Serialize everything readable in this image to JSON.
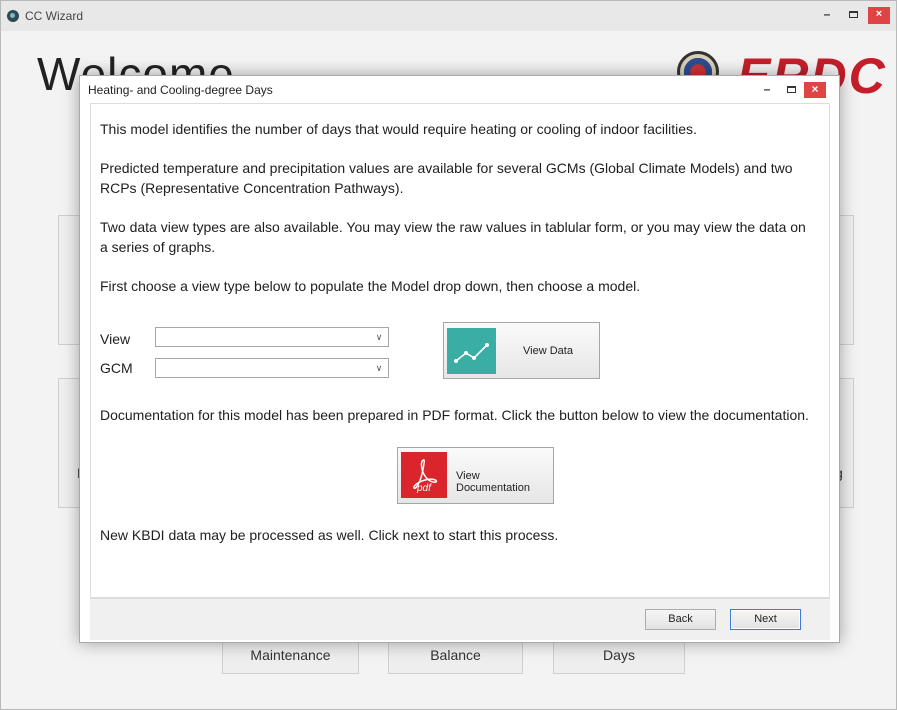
{
  "main_window": {
    "title": "CC Wizard",
    "heading": "Welcome",
    "logo_text": "ERDC",
    "controls": {
      "minimize": "–",
      "close": "×"
    },
    "partial_labels": {
      "left": "M",
      "right": "g"
    },
    "bottom_buttons": [
      {
        "label": "Maintenance"
      },
      {
        "label": "Balance"
      },
      {
        "label": "Days"
      }
    ]
  },
  "dialog": {
    "title": "Heating- and Cooling-degree Days",
    "controls": {
      "minimize": "–",
      "close": "×"
    },
    "paragraphs": {
      "intro": "This model identifies the number of days that would require heating or cooling of indoor facilities.",
      "values": "Predicted temperature and precipitation values are available for several GCMs (Global Climate Models) and two RCPs (Representative Concentration Pathways).",
      "view_types": "Two data view types are also available. You may view the raw values in tablular form, or you may view the data on a series of graphs.",
      "instructions": "First choose a view type below to populate the Model drop down, then choose a model.",
      "documentation": "Documentation for this model has been prepared in PDF format. Click the button below to view the documentation.",
      "kbdi": "New KBDI data may be processed as well. Click next to start this process."
    },
    "fields": {
      "view_label": "View",
      "view_value": "",
      "gcm_label": "GCM",
      "gcm_value": "",
      "arrow": "∨"
    },
    "buttons": {
      "view_data": "View Data",
      "view_documentation": "View Documentation",
      "pdf_badge": "pdf",
      "back": "Back",
      "next": "Next"
    },
    "colors": {
      "chart_tile": "#3aaea4",
      "pdf_tile": "#d9252b",
      "close_button": "#e04343",
      "logo": "#c41e2a"
    },
    "icons": [
      "line-chart-icon",
      "pdf-icon",
      "minimize-icon",
      "maximize-icon",
      "close-icon",
      "dropdown-arrow-icon"
    ]
  }
}
